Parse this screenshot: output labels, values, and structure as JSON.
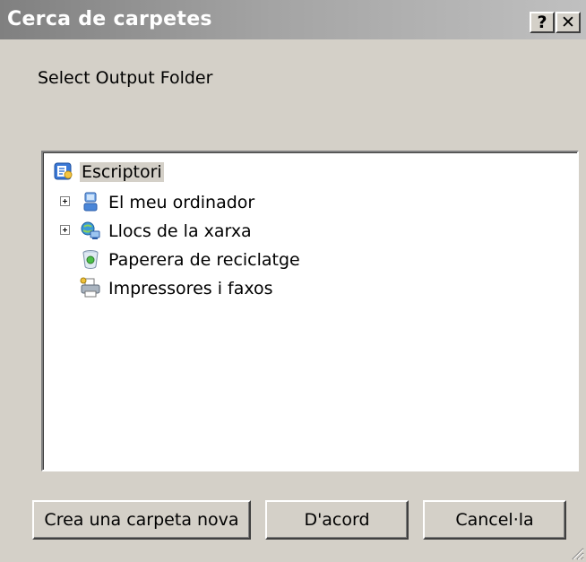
{
  "window": {
    "title": "Cerca de carpetes",
    "help_label": "?",
    "close_label": "✕"
  },
  "prompt": "Select Output Folder",
  "tree": {
    "items": [
      {
        "label": "Escriptori",
        "icon": "desktop-icon",
        "selected": true
      },
      {
        "label": "El meu ordinador",
        "icon": "computer-icon",
        "expandable": true
      },
      {
        "label": "Llocs de la xarxa",
        "icon": "network-icon",
        "expandable": true
      },
      {
        "label": "Paperera de reciclatge",
        "icon": "recycle-bin-icon"
      },
      {
        "label": "Impressores i faxos",
        "icon": "printer-icon"
      }
    ]
  },
  "buttons": {
    "new_folder": "Crea una carpeta nova",
    "ok": "D'acord",
    "cancel": "Cancel·la"
  },
  "colors": {
    "dialog_bg": "#d4d0c8",
    "title_gradient_start": "#808080",
    "title_gradient_end": "#c0c0c0",
    "tree_bg": "#ffffff"
  }
}
